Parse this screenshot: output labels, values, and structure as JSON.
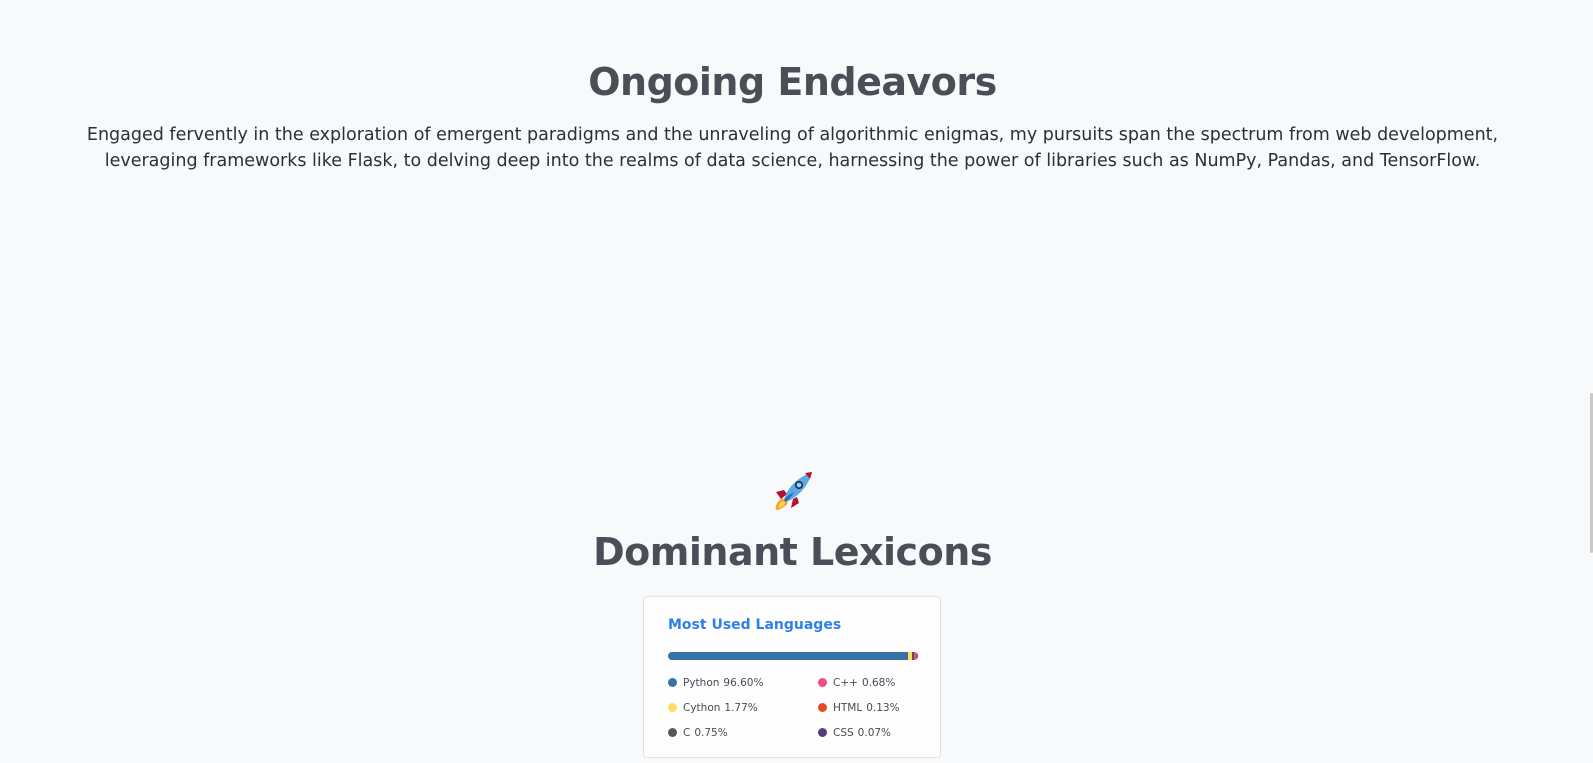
{
  "endeavors": {
    "title": "Ongoing Endeavors",
    "description": "Engaged fervently in the exploration of emergent paradigms and the unraveling of algorithmic enigmas, my pursuits span the spectrum from web development, leveraging frameworks like Flask, to delving deep into the realms of data science, harnessing the power of libraries such as NumPy, Pandas, and TensorFlow."
  },
  "decoration": {
    "icon": "rocket-icon"
  },
  "lexicons": {
    "title": "Dominant Lexicons",
    "card": {
      "title": "Most Used Languages",
      "languages": [
        {
          "name": "Python",
          "percent_label": "96.60%",
          "percent": 96.6,
          "color": "#3572A5"
        },
        {
          "name": "C++",
          "percent_label": "0.68%",
          "percent": 0.68,
          "color": "#f34b7d"
        },
        {
          "name": "Cython",
          "percent_label": "1.77%",
          "percent": 1.77,
          "color": "#fedf5b"
        },
        {
          "name": "HTML",
          "percent_label": "0.13%",
          "percent": 0.13,
          "color": "#e34c26"
        },
        {
          "name": "C",
          "percent_label": "0.75%",
          "percent": 0.75,
          "color": "#555555"
        },
        {
          "name": "CSS",
          "percent_label": "0.07%",
          "percent": 0.07,
          "color": "#563d7c"
        }
      ]
    }
  }
}
